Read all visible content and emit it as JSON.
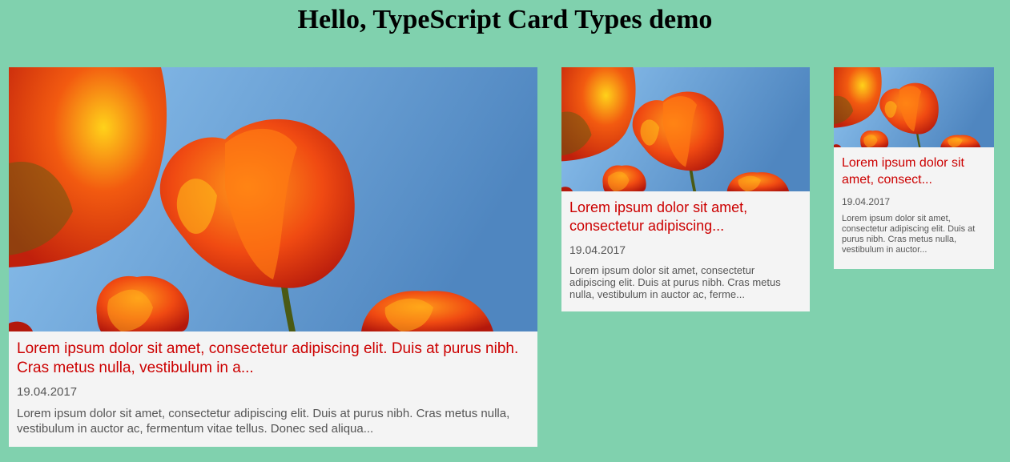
{
  "page": {
    "title": "Hello, TypeScript Card Types demo"
  },
  "colors": {
    "background": "#80d1ae",
    "card_background": "#f4f4f4",
    "title_red": "#cc0000",
    "text_gray": "#555555",
    "sky": "#6fa7dc"
  },
  "cards": [
    {
      "size": "large",
      "image": "tulips-photo",
      "title": "Lorem ipsum dolor sit amet, consectetur adipiscing elit. Duis at purus nibh. Cras metus nulla, vestibulum in a...",
      "date": "19.04.2017",
      "excerpt": "Lorem ipsum dolor sit amet, consectetur adipiscing elit. Duis at purus nibh. Cras metus nulla, vestibulum in auctor ac, fermentum vitae tellus. Donec sed aliqua..."
    },
    {
      "size": "medium",
      "image": "tulips-photo",
      "title": "Lorem ipsum dolor sit amet, consectetur adipiscing...",
      "date": "19.04.2017",
      "excerpt": "Lorem ipsum dolor sit amet, consectetur adipiscing elit. Duis at purus nibh. Cras metus nulla, vestibulum in auctor ac, ferme..."
    },
    {
      "size": "small",
      "image": "tulips-photo",
      "title": "Lorem ipsum dolor sit amet, consect...",
      "date": "19.04.2017",
      "excerpt": "Lorem ipsum dolor sit amet, consectetur adipiscing elit. Duis at purus nibh. Cras metus nulla, vestibulum in auctor..."
    }
  ]
}
